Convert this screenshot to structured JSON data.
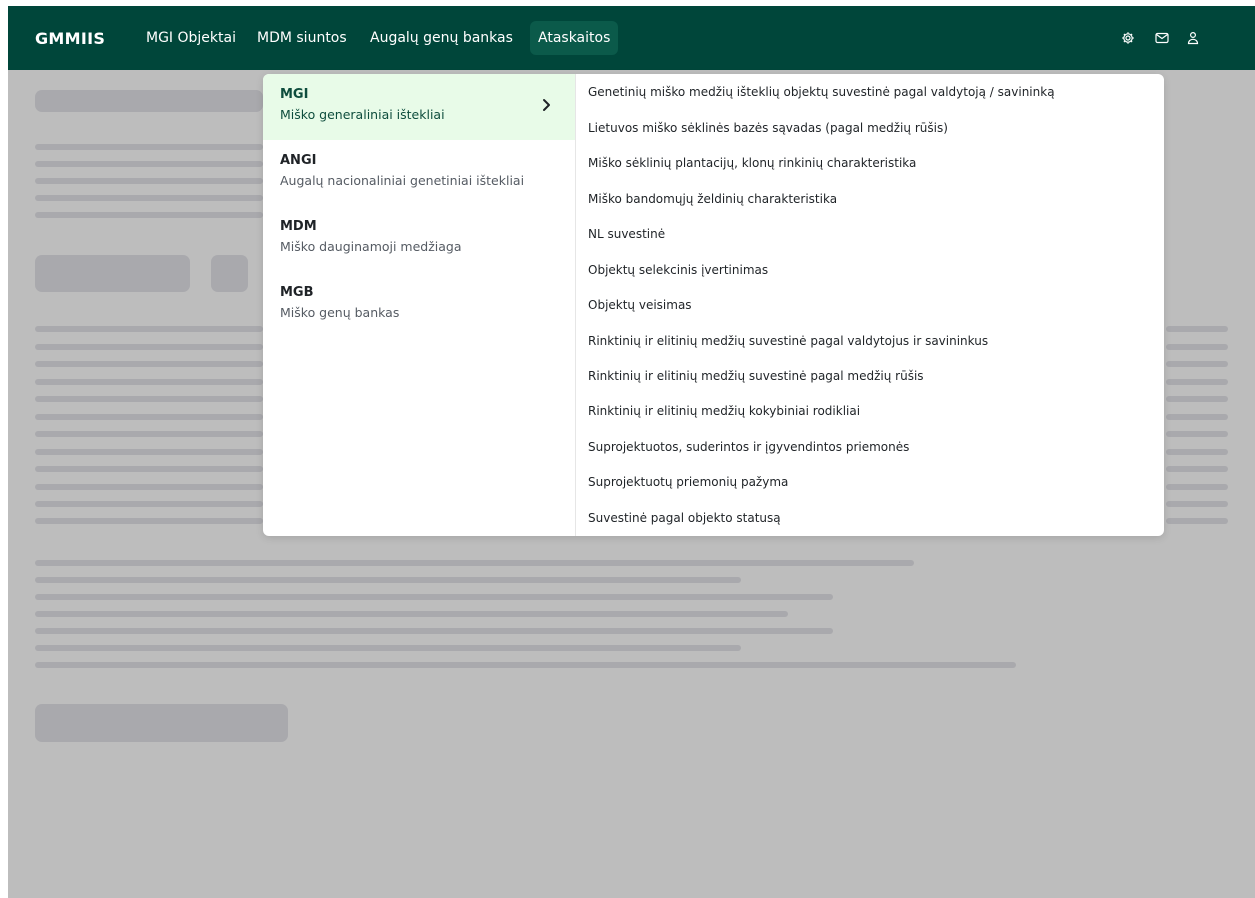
{
  "app": {
    "brand": "GMMIIS"
  },
  "nav": {
    "items": [
      {
        "label": "MGI Objektai"
      },
      {
        "label": "MDM siuntos"
      },
      {
        "label": "Augalų genų bankas"
      },
      {
        "label": "Ataskaitos",
        "active": true
      }
    ],
    "icons": [
      "gear-icon",
      "mail-icon",
      "user-icon"
    ]
  },
  "dropdown": {
    "categories": [
      {
        "code": "MGI",
        "name": "Miško generaliniai ištekliai",
        "active": true
      },
      {
        "code": "ANGI",
        "name": "Augalų nacionaliniai genetiniai ištekliai"
      },
      {
        "code": "MDM",
        "name": "Miško dauginamoji medžiaga"
      },
      {
        "code": "MGB",
        "name": "Miško genų bankas"
      }
    ],
    "reports": [
      "Genetinių miško medžių išteklių objektų suvestinė pagal valdytoją / savininką",
      "Lietuvos miško sėklinės bazės sąvadas (pagal medžių rūšis)",
      "Miško sėklinių plantacijų, klonų rinkinių charakteristika",
      "Miško bandomųjų želdinių charakteristika",
      "NL suvestinė",
      "Objektų selekcinis įvertinimas",
      "Objektų veisimas",
      "Rinktinių ir elitinių medžių suvestinė pagal valdytojus ir savininkus",
      "Rinktinių ir elitinių medžių suvestinė pagal medžių rūšis",
      "Rinktinių ir elitinių medžių kokybiniai rodikliai",
      "Suprojektuotos, suderintos ir įgyvendintos priemonės",
      "Suprojektuotų priemonių pažyma",
      "Suvestinė pagal objekto statusą"
    ]
  },
  "colors": {
    "topbar": "#00463a",
    "active_nav": "#0b5a4a",
    "active_category_bg": "#e8fbe8",
    "overlay": "#bdbdbd",
    "skeleton": "#a9a9ad"
  }
}
